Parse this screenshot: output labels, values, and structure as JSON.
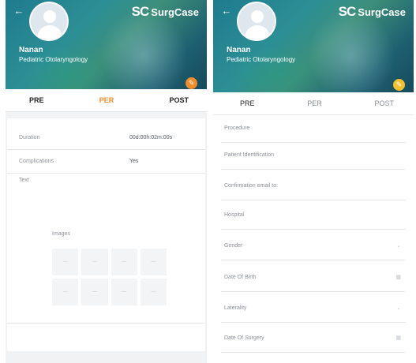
{
  "left_screen": {
    "brand": {
      "mark": "SC",
      "name": "SurgCase"
    },
    "user": {
      "name": "Nanan",
      "specialty": "Pediatric Otolaryngology"
    },
    "tabs": [
      {
        "label": "PRE",
        "active": false
      },
      {
        "label": "PER",
        "active": true
      },
      {
        "label": "POST",
        "active": false
      }
    ],
    "fields": [
      {
        "label": "Duration",
        "value": "00d:00h:02m:00s"
      },
      {
        "label": "Complications",
        "value": "Yes"
      }
    ],
    "text_label": "Text",
    "images_label": "Images",
    "image_slots": 8,
    "accent_color": "#f08c2a"
  },
  "right_screen": {
    "brand": {
      "mark": "SC",
      "name": "SurgCase"
    },
    "user": {
      "name": "Nanan",
      "specialty": "Pediatric Otolaryngology"
    },
    "tabs": [
      {
        "label": "PRE",
        "active": true
      },
      {
        "label": "PER",
        "active": false
      },
      {
        "label": "POST",
        "active": false
      }
    ],
    "form_fields": [
      {
        "label": "Procedure",
        "control": "none"
      },
      {
        "label": "Patient Identification",
        "control": "none"
      },
      {
        "label": "Confirmation email to:",
        "control": "none"
      },
      {
        "label": "Hospital",
        "control": "none"
      },
      {
        "label": "Gender",
        "control": "chevron-down-icon"
      },
      {
        "label": "Date Of Birth",
        "control": "calendar-icon"
      },
      {
        "label": "Laterality",
        "control": "chevron-down-icon"
      },
      {
        "label": "Date Of Surgery",
        "control": "calendar-icon"
      }
    ],
    "accent_color": "#f3c02f"
  },
  "colors": {
    "header_teal": "#1e7b8e",
    "divider": "#e5e7ea",
    "muted_text": "#8c9096"
  }
}
